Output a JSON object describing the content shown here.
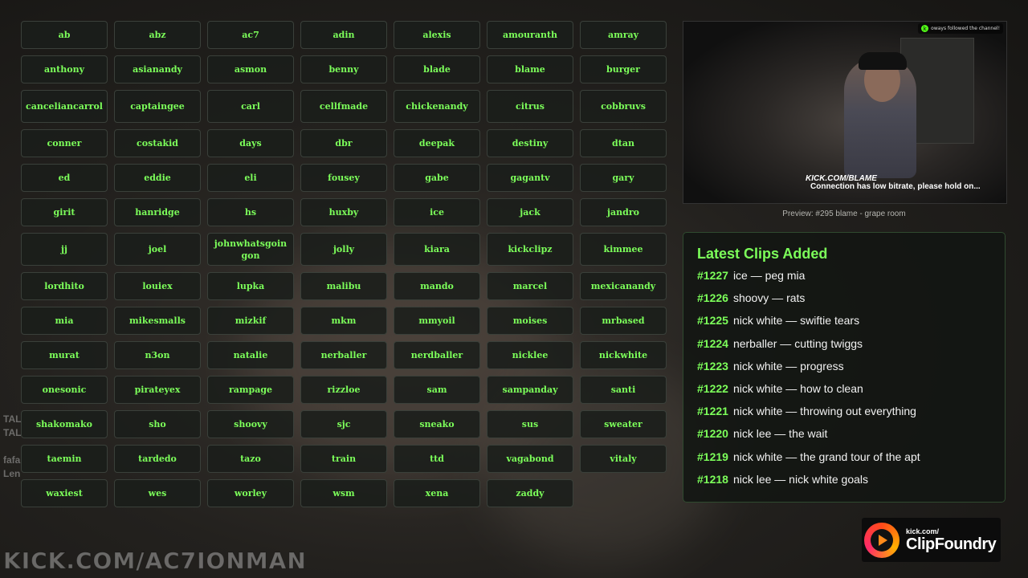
{
  "streamer_buttons": [
    "ab",
    "abz",
    "ac7",
    "adin",
    "alexis",
    "amouranth",
    "amray",
    "anthony",
    "asianandy",
    "asmon",
    "benny",
    "blade",
    "blame",
    "burger",
    "canceliancarrol",
    "captaingee",
    "carl",
    "cellfmade",
    "chickenandy",
    "citrus",
    "cobbruvs",
    "conner",
    "costakid",
    "days",
    "dbr",
    "deepak",
    "destiny",
    "dtan",
    "ed",
    "eddie",
    "eli",
    "fousey",
    "gabe",
    "gagantv",
    "gary",
    "girit",
    "hanridge",
    "hs",
    "huxby",
    "ice",
    "jack",
    "jandro",
    "jj",
    "joel",
    "johnwhatsgoingon",
    "jolly",
    "kiara",
    "kickclipz",
    "kimmee",
    "lordhito",
    "louiex",
    "lupka",
    "malibu",
    "mando",
    "marcel",
    "mexicanandy",
    "mia",
    "mikesmalls",
    "mizkif",
    "mkm",
    "mmyoil",
    "moises",
    "mrbased",
    "murat",
    "n3on",
    "natalie",
    "nerballer",
    "nerdballer",
    "nicklee",
    "nickwhite",
    "onesonic",
    "pirateyex",
    "rampage",
    "rizzloe",
    "sam",
    "sampanday",
    "santi",
    "shakomako",
    "sho",
    "shoovy",
    "sjc",
    "sneako",
    "sus",
    "sweater",
    "taemin",
    "tardedo",
    "tazo",
    "train",
    "ttd",
    "vagabond",
    "vitaly",
    "waxiest",
    "wes",
    "worley",
    "wsm",
    "xena",
    "zaddy"
  ],
  "preview": {
    "follow_note": "oways followed the channel!",
    "kick_url": "KICK.COM/BLAME",
    "bitrate_warning": "Connection has low bitrate, please hold on...",
    "caption": "Preview: #295 blame - grape room"
  },
  "latest_clips": {
    "title": "Latest Clips Added",
    "items": [
      {
        "num": "#1227",
        "text": "ice — peg mia"
      },
      {
        "num": "#1226",
        "text": "shoovy — rats"
      },
      {
        "num": "#1225",
        "text": "nick white — swiftie tears"
      },
      {
        "num": "#1224",
        "text": "nerballer — cutting twiggs"
      },
      {
        "num": "#1223",
        "text": "nick white — progress"
      },
      {
        "num": "#1222",
        "text": "nick white — how to clean"
      },
      {
        "num": "#1221",
        "text": "nick white — throwing out everything"
      },
      {
        "num": "#1220",
        "text": "nick lee — the wait"
      },
      {
        "num": "#1219",
        "text": "nick white — the grand tour of the apt"
      },
      {
        "num": "#1218",
        "text": "nick lee — nick white goals"
      }
    ]
  },
  "brand": {
    "small": "kick.com/",
    "big": "ClipFoundry"
  },
  "watermark": "KICK.COM/AC7IONMAN",
  "colors": {
    "accent": "#7cff5a",
    "kick_green": "#53fc18"
  }
}
